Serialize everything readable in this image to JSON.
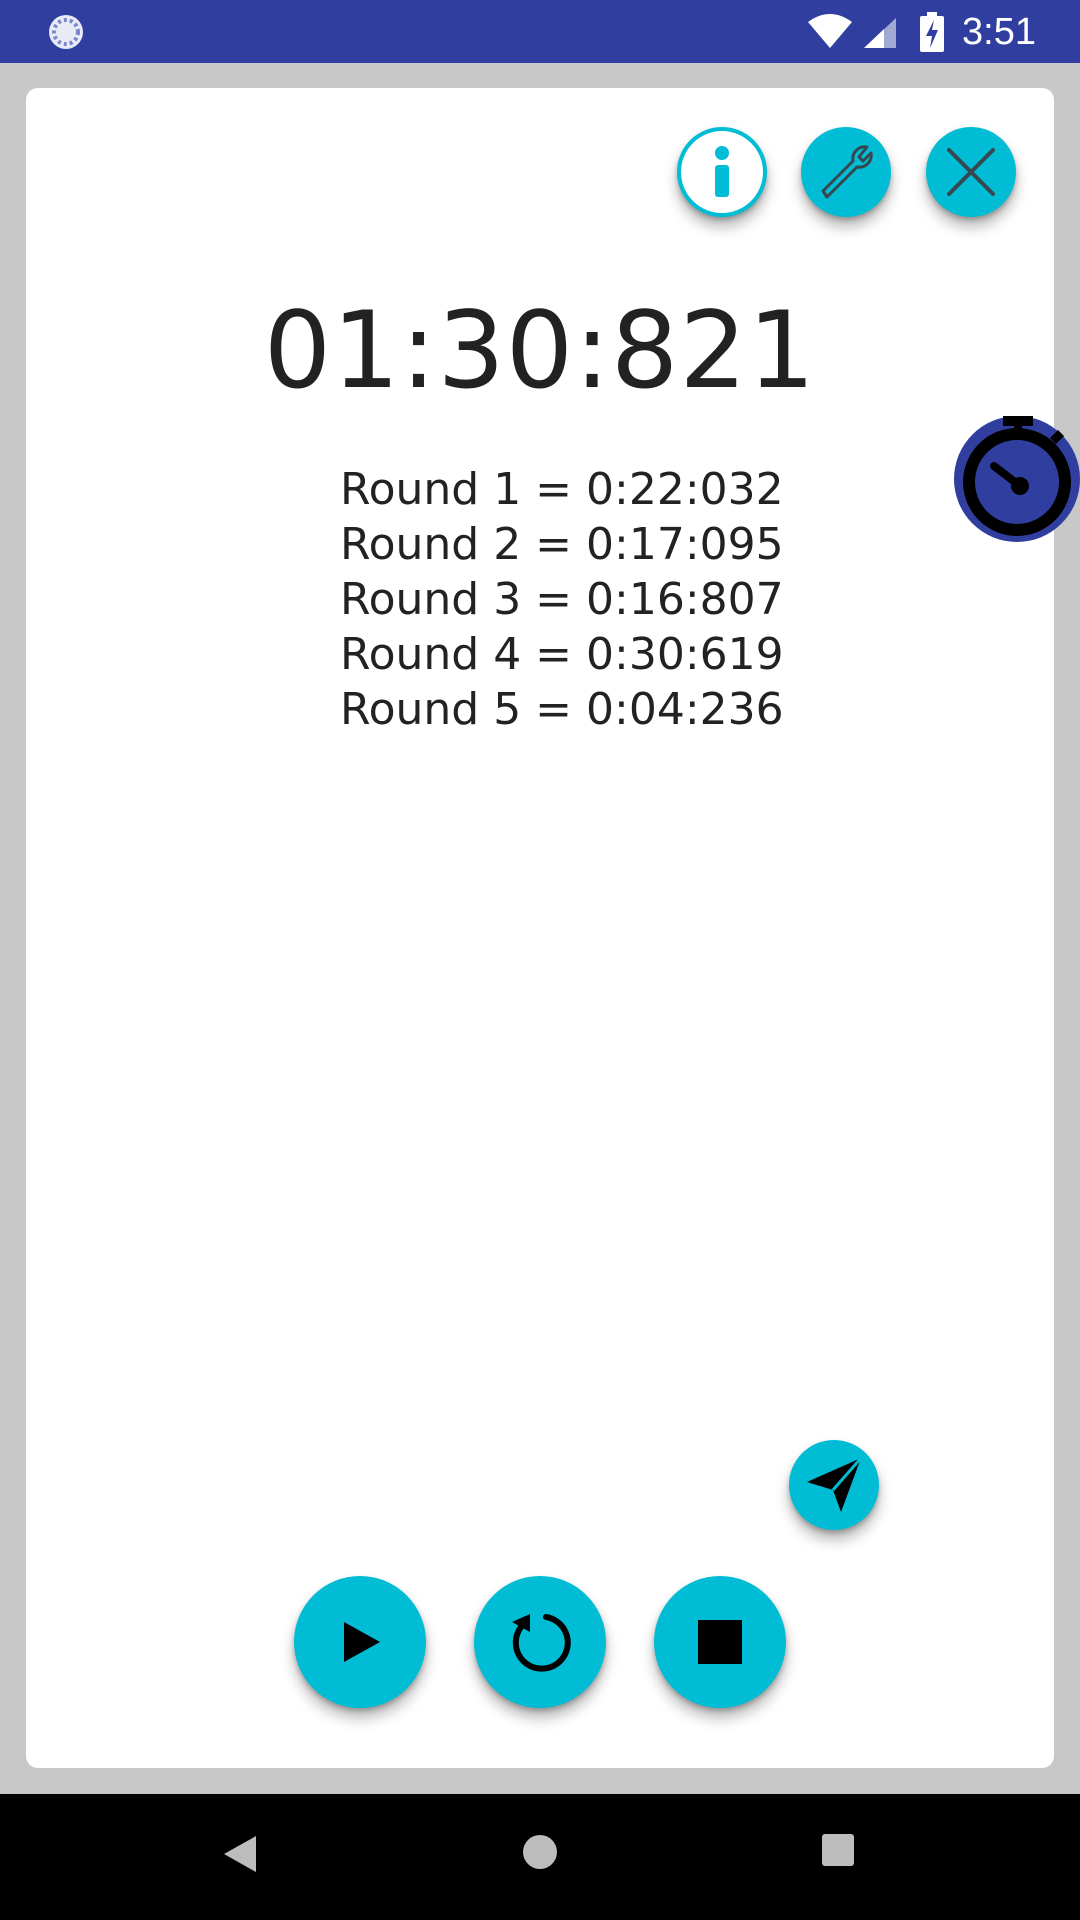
{
  "status_bar": {
    "time": "3:51",
    "background_color": "#303f9f",
    "icons": [
      "sync-status-icon",
      "wifi-icon",
      "cell-signal-icon",
      "battery-charging-icon"
    ]
  },
  "header_buttons": [
    {
      "icon": "info-icon"
    },
    {
      "icon": "wrench-icon"
    },
    {
      "icon": "close-icon"
    }
  ],
  "timer": {
    "elapsed": "01:30:821"
  },
  "rounds": [
    "Round 1 = 0:22:032",
    "Round 2 = 0:17:095",
    "Round 3 = 0:16:807",
    "Round 4 = 0:30:619",
    "Round 5 = 0:04:236"
  ],
  "floating": {
    "stopwatch_icon": "stopwatch-icon",
    "send_icon": "send-icon"
  },
  "controls": {
    "play_icon": "play-icon",
    "reset_icon": "reset-icon",
    "stop_icon": "stop-icon"
  },
  "nav_bar": {
    "icons": [
      "back-icon",
      "home-icon",
      "recents-icon"
    ]
  },
  "colors": {
    "accent": "#00bcd4",
    "primary": "#303f9f",
    "text": "#222222"
  }
}
